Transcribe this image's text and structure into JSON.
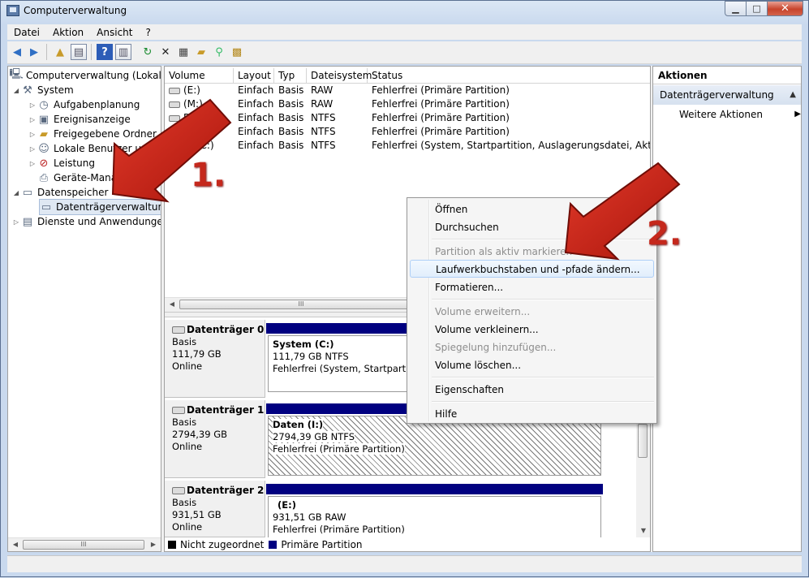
{
  "window": {
    "title": "Computerverwaltung",
    "min": "▁",
    "max": "□",
    "close": "✕"
  },
  "menu": [
    "Datei",
    "Aktion",
    "Ansicht",
    "?"
  ],
  "tree": {
    "root": "Computerverwaltung (Lokal)",
    "system": "System",
    "items": [
      "Aufgabenplanung",
      "Ereignisanzeige",
      "Freigegebene Ordner",
      "Lokale Benutzer und",
      "Leistung",
      "Geräte-Manag"
    ],
    "storage": "Datenspeicher",
    "disk_mgmt": "Datenträgerverwaltung",
    "services": "Dienste und Anwendungen"
  },
  "volumes": {
    "columns": [
      "Volume",
      "Layout",
      "Typ",
      "Dateisystem",
      "Status"
    ],
    "rows": [
      {
        "volume": "(E:)",
        "layout": "Einfach",
        "typ": "Basis",
        "fs": "RAW",
        "status": "Fehlerfrei (Primäre Partition)"
      },
      {
        "volume": "(M:)",
        "layout": "Einfach",
        "typ": "Basis",
        "fs": "RAW",
        "status": "Fehlerfrei (Primäre Partition)"
      },
      {
        "volume": "D",
        "layout": "Einfach",
        "typ": "Basis",
        "fs": "NTFS",
        "status": "Fehlerfrei (Primäre Partition)"
      },
      {
        "volume": "(F:)",
        "layout": "Einfach",
        "typ": "Basis",
        "fs": "NTFS",
        "status": "Fehlerfrei (Primäre Partition)"
      },
      {
        "volume": "stem (C:)",
        "layout": "Einfach",
        "typ": "Basis",
        "fs": "NTFS",
        "status": "Fehlerfrei (System, Startpartition, Auslagerungsdatei, Aktiv, Absturz"
      }
    ]
  },
  "disks": [
    {
      "name": "Datenträger 0",
      "type": "Basis",
      "size": "111,79 GB",
      "state": "Online",
      "part_title": "System  (C:)",
      "part_size": "111,79 GB NTFS",
      "part_status": "Fehlerfrei (System, Startpartition"
    },
    {
      "name": "Datenträger 1",
      "type": "Basis",
      "size": "2794,39 GB",
      "state": "Online",
      "part_title": "Daten  (I:)",
      "part_size": "2794,39 GB NTFS",
      "part_status": "Fehlerfrei (Primäre Partition)"
    },
    {
      "name": "Datenträger 2",
      "type": "Basis",
      "size": "931,51 GB",
      "state": "Online",
      "part_title": "(E:)",
      "part_size": "931,51 GB RAW",
      "part_status": "Fehlerfrei (Primäre Partition)"
    }
  ],
  "legend": {
    "unallocated": "Nicht zugeordnet",
    "primary": "Primäre Partition"
  },
  "actions": {
    "header": "Aktionen",
    "section": "Datenträgerverwaltung",
    "more": "Weitere Aktionen"
  },
  "context_menu": {
    "open": "Öffnen",
    "browse": "Durchsuchen",
    "mark_active": "Partition als aktiv markieren",
    "change_letter": "Laufwerkbuchstaben und -pfade ändern...",
    "format": "Formatieren...",
    "extend": "Volume erweitern...",
    "shrink": "Volume verkleinern...",
    "mirror": "Spiegelung hinzufügen...",
    "delete": "Volume löschen...",
    "properties": "Eigenschaften",
    "help": "Hilfe"
  },
  "annotations": {
    "step1": "1.",
    "step2": "2."
  },
  "colors": {
    "primary_partition": "#000080",
    "unallocated": "#000000",
    "arrow": "#c5281c"
  },
  "scroll_glyph": "III"
}
